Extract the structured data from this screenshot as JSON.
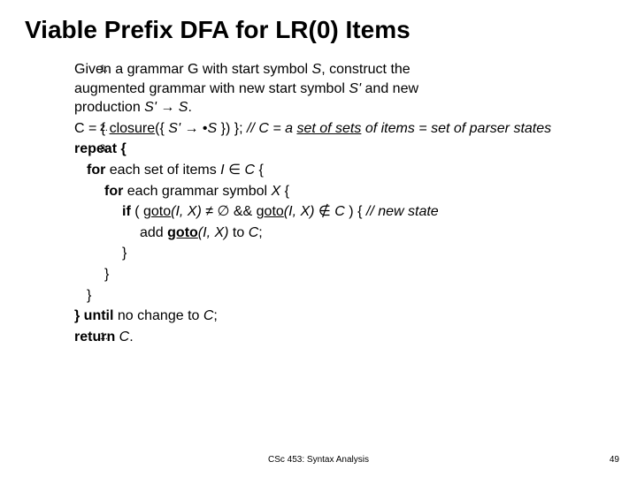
{
  "title": "Viable Prefix DFA for LR(0) Items",
  "nums": {
    "n1": "1.",
    "n2": "2.",
    "n3": "3.",
    "n4": "1."
  },
  "step1a": "Given a grammar G with start symbol ",
  "step1b": ", construct the",
  "step1c": "augmented grammar with new start symbol ",
  "step1d": " and new",
  "step1e": "production ",
  "sym_S": "S",
  "sym_Sp": "S'",
  "arrow": " → ",
  "dot": ".",
  "step2a": "C = { ",
  "closure": "closure",
  "step2b": "({ ",
  "step2c": " }) };  ",
  "bulletdot": "•",
  "comment2a": "// C  =  a ",
  "comment2b": "set of sets",
  "comment2c": " of items = set of parser states",
  "repeat": "repeat {",
  "forI": "for",
  "forIa": " each set of items ",
  "sym_I": "I",
  "in": " ∈ ",
  "sym_C": "C",
  "brace": " {",
  "forXa": " each grammar symbol ",
  "sym_X": "X",
  "if": "if",
  "ifb": " ( ",
  "goto": "goto",
  "gotoargs": "(I, X)",
  "neq": " ≠ ∅   &&   ",
  "notin": " ∉ ",
  "ifc": " ) {        ",
  "newstate": "// new state",
  "add": "add ",
  "toC": " to ",
  "semi": ";",
  "closebrace": "}",
  "until": "} until",
  "untilb": " no change to ",
  "return": "return ",
  "footer_center": "CSc 453: Syntax Analysis",
  "footer_right": "49"
}
